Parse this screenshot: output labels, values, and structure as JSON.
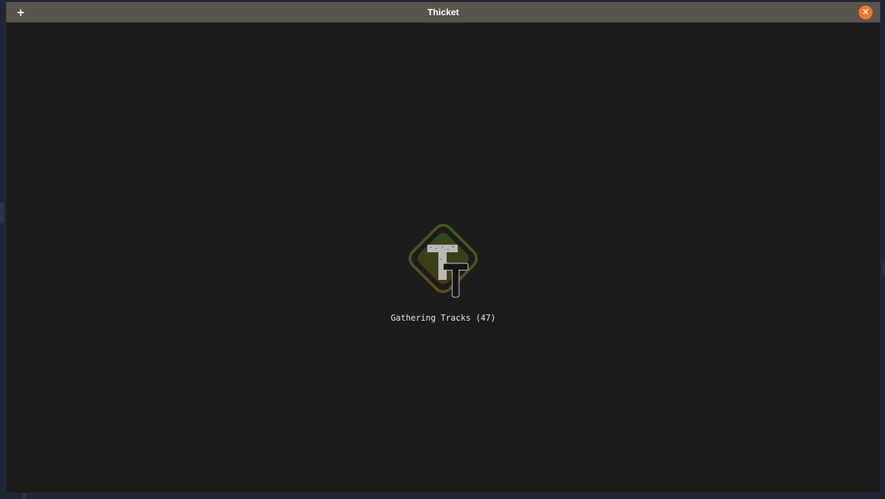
{
  "window": {
    "title": "Thicket",
    "new_tab_label": "+",
    "close_label": "×"
  },
  "loading": {
    "status_text": "Gathering Tracks (47)"
  },
  "logo": {
    "icon": "thicket-logo-icon",
    "letter": "T"
  },
  "colors": {
    "titlebar": "#5a544f",
    "background": "#1c1c1c",
    "close_button": "#f0782a",
    "logo_ring_green": "#3f5a1f",
    "logo_ring_brown": "#5a4a1c"
  }
}
